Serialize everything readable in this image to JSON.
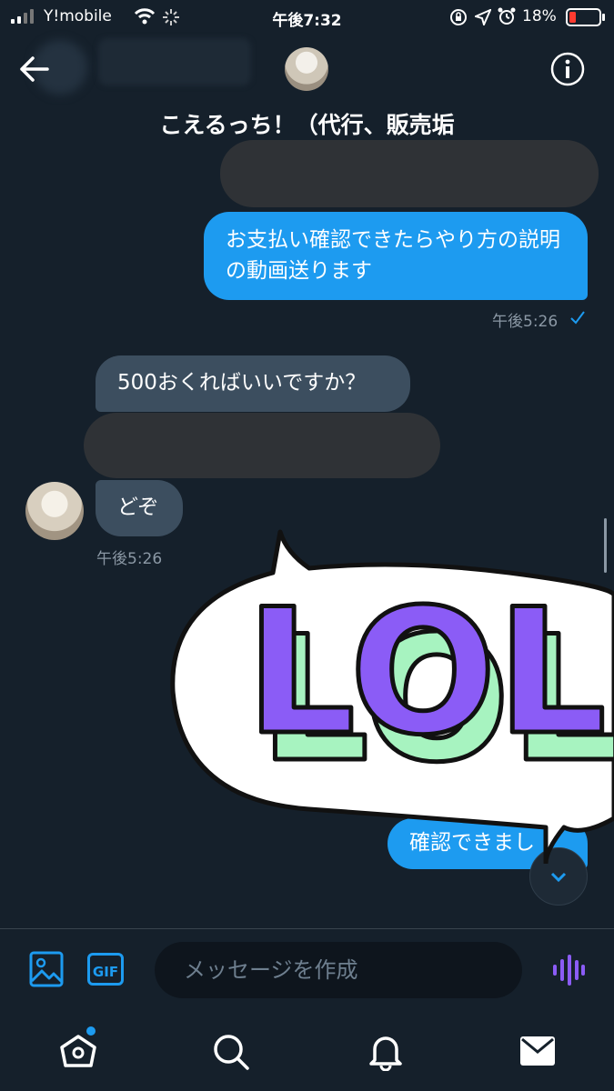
{
  "status_bar": {
    "carrier": "Y!mobile",
    "time": "午後7:32",
    "battery": "18%"
  },
  "header": {
    "title": "こえるっち！（代行、販売垢"
  },
  "messages": {
    "out_1": "お支払い確認できたらやり方の説明の動画送ります",
    "out_1_time": "午後5:26",
    "in_1": "500おくればいいですか？",
    "in_2": "どぞ",
    "in_time": "午後5:26",
    "out_2_partial": "確認できまし"
  },
  "sticker": {
    "text": "LOL",
    "fill_color": "#8b5cf6",
    "shade_color": "#a7f3c0"
  },
  "composer": {
    "placeholder": "メッセージを作成",
    "gif_label": "GIF"
  },
  "colors": {
    "background": "#15202b",
    "accent": "#1d9bf0",
    "incoming_bubble": "#3c4e5f",
    "voice_icon": "#8b5cf6"
  }
}
